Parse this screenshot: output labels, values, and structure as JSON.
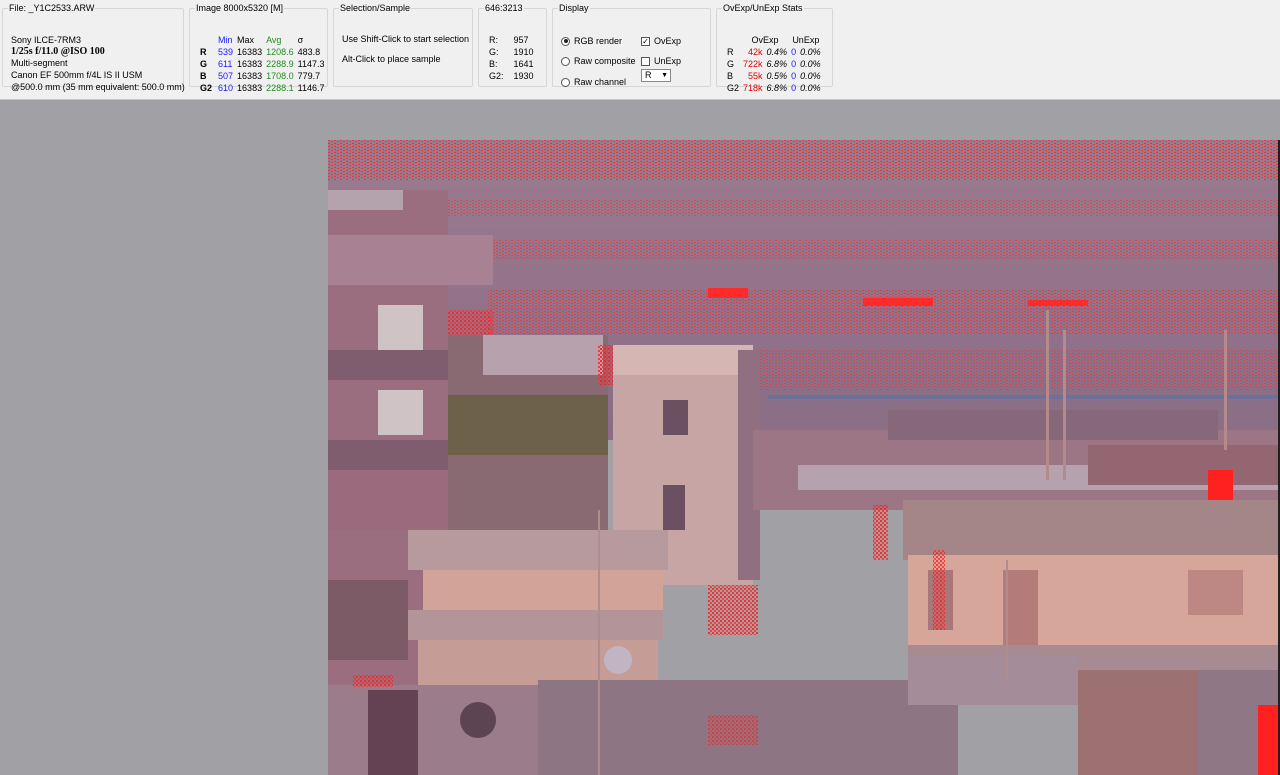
{
  "file": {
    "title": "File: _Y1C2533.ARW",
    "camera": "Sony ILCE-7RM3",
    "exposure": "1/25s f/11.0 @ISO 100",
    "metering": "Multi-segment",
    "lens": "Canon EF 500mm f/4L IS II USM",
    "focal": "@500.0 mm (35 mm equivalent: 500.0 mm)"
  },
  "image": {
    "title": "Image 8000x5320 [M]",
    "headers": [
      "Min",
      "Max",
      "Avg",
      "σ"
    ],
    "rows": [
      {
        "ch": "R",
        "min": "539",
        "max": "16383",
        "avg": "1208.6",
        "sd": "483.8"
      },
      {
        "ch": "G",
        "min": "611",
        "max": "16383",
        "avg": "2288.9",
        "sd": "1147.3"
      },
      {
        "ch": "B",
        "min": "507",
        "max": "16383",
        "avg": "1708.0",
        "sd": "779.7"
      },
      {
        "ch": "G2",
        "min": "610",
        "max": "16383",
        "avg": "2288.1",
        "sd": "1146.7"
      }
    ]
  },
  "selection": {
    "title": "Selection/Sample",
    "hint1": "Use Shift-Click to start selection",
    "hint2": "Alt-Click to place sample"
  },
  "sample": {
    "title": "646:3213",
    "rows": [
      {
        "ch": "R:",
        "val": "957"
      },
      {
        "ch": "G:",
        "val": "1910"
      },
      {
        "ch": "B:",
        "val": "1641"
      },
      {
        "ch": "G2:",
        "val": "1930"
      }
    ]
  },
  "display": {
    "title": "Display",
    "rgb_render": "RGB render",
    "raw_composite": "Raw composite",
    "raw_channel": "Raw channel",
    "ovexp": "OvExp",
    "unexp": "UnExp",
    "channel_value": "R",
    "selected_mode": "RGB render",
    "ovexp_checked": true,
    "unexp_checked": false
  },
  "ovexp_stats": {
    "title": "OvExp/UnExp Stats",
    "headers": [
      "OvExp",
      "UnExp"
    ],
    "rows": [
      {
        "ch": "R",
        "ov_count": "42k",
        "ov_pct": "0.4%",
        "un_count": "0",
        "un_pct": "0.0%"
      },
      {
        "ch": "G",
        "ov_count": "722k",
        "ov_pct": "6.8%",
        "un_count": "0",
        "un_pct": "0.0%"
      },
      {
        "ch": "B",
        "ov_count": "55k",
        "ov_pct": "0.5%",
        "un_count": "0",
        "un_pct": "0.0%"
      },
      {
        "ch": "G2",
        "ov_count": "718k",
        "ov_pct": "6.8%",
        "un_count": "0",
        "un_pct": "0.0%"
      }
    ]
  },
  "colors": {
    "panel_bg": "#f0f0f0",
    "workspace_bg": "#a1a1a5",
    "min_blue": "#1a1aff",
    "avg_green": "#1e8f1e",
    "ovexp_red": "#e00000",
    "overexposure_overlay": "#ff2a2a"
  }
}
